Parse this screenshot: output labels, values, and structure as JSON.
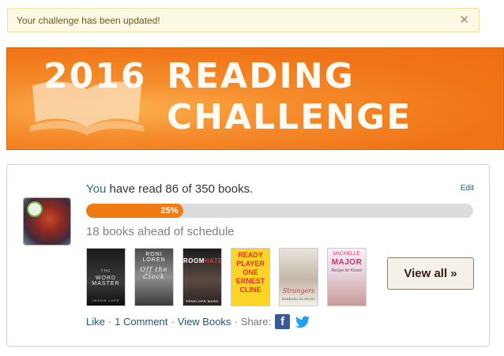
{
  "notice": {
    "text": "Your challenge has been updated!",
    "close_glyph": "✕",
    "background": "#fbf8e3"
  },
  "banner": {
    "year": "2016",
    "line1": "READING",
    "line2": "CHALLENGE",
    "icon": "open-book-icon",
    "background": "#f07417"
  },
  "challenge": {
    "edit_label": "Edit",
    "read_you": "You",
    "read_rest": " have read 86 of 350 books.",
    "books_read": 86,
    "books_goal": 350,
    "progress_percent": 25,
    "progress_label": "25%",
    "schedule_text": "18 books ahead of schedule",
    "accent_color": "#f07b12",
    "view_all_label": "View all »"
  },
  "covers": [
    {
      "top": "THE",
      "title": "WORD MASTER",
      "bottom": "JASON LUKE"
    },
    {
      "top": "RONI LOREN",
      "title": "Off the Clock"
    },
    {
      "title_a": "ROOM",
      "title_b": "HATE",
      "bottom": "PENELOPE WARD"
    },
    {
      "title": "READY PLAYER ONE ERNEST CLINE"
    },
    {
      "title": "Strangers",
      "bottom": "BARBARA ELSBORG"
    },
    {
      "top": "MICHELLE",
      "title": "MAJOR",
      "subtitle": "Recipe for Kisses"
    }
  ],
  "actions": {
    "like": "Like",
    "comment": "1 Comment",
    "view_books": "View Books",
    "share": "Share:",
    "sep": "·",
    "facebook_glyph": "f",
    "facebook_color": "#3b5998",
    "twitter_color": "#1da1f2"
  }
}
